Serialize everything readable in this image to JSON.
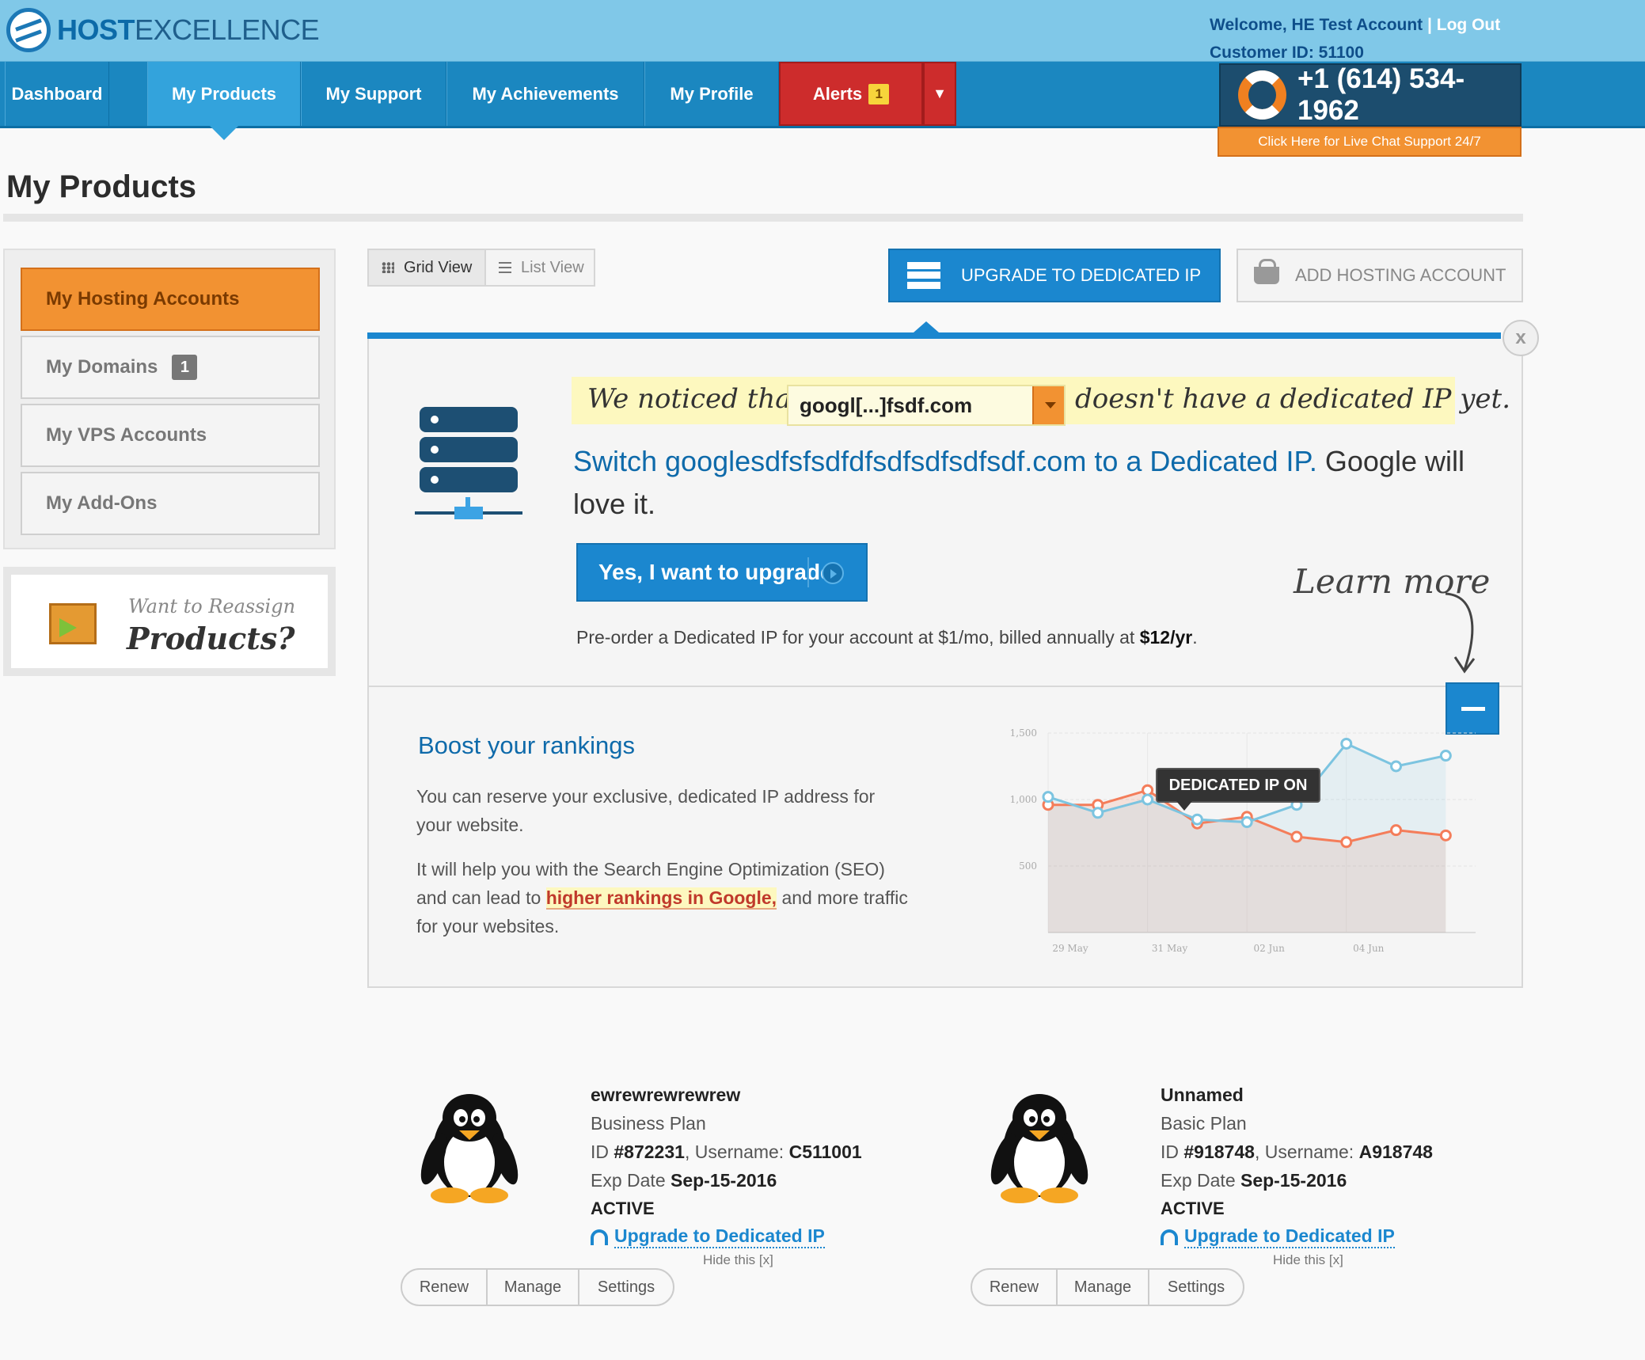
{
  "header": {
    "logo_host": "HOST",
    "logo_excellence": "EXCELLENCE",
    "welcome": "Welcome, HE Test Account",
    "separator": "|",
    "logout": "Log Out",
    "customer_id": "Customer ID: 51100",
    "phone": "+1 (614) 534-1962",
    "chat": "Click Here for Live Chat Support 24/7"
  },
  "nav": {
    "items": [
      "Dashboard",
      "My Products",
      "My Support",
      "My Achievements",
      "My Profile"
    ],
    "alerts_label": "Alerts",
    "alerts_count": "1"
  },
  "page": {
    "title": "My Products"
  },
  "sidebar": {
    "items": [
      {
        "label": "My Hosting Accounts"
      },
      {
        "label": "My Domains",
        "badge": "1"
      },
      {
        "label": "My VPS Accounts"
      },
      {
        "label": "My Add-Ons"
      }
    ],
    "reassign_small": "Want to Reassign",
    "reassign_big": "Products?"
  },
  "toolbar": {
    "grid_view": "Grid View",
    "list_view": "List View",
    "upgrade_ip": "UPGRADE TO DEDICATED IP",
    "add_hosting": "ADD HOSTING ACCOUNT",
    "close": "x"
  },
  "promo": {
    "notice_before": "We noticed that",
    "domain_selected": "googl[...]fsdf.com",
    "notice_after": "doesn't have a dedicated IP yet.",
    "switch_blue": "Switch googlesdfsfsdfdfsdfsdfsdfsdf.com to a Dedicated IP.",
    "switch_rest": "Google will love it.",
    "yes_button": "Yes, I want to upgrade",
    "preorder": "Pre-order a Dedicated IP for your account at $1/mo, billed annually at",
    "preorder_price": "$12/yr",
    "preorder_end": ".",
    "learn_more": "Learn more",
    "boost_title": "Boost your rankings",
    "boost_p1": "You can reserve your exclusive, dedicated IP address for your website.",
    "boost_p2_a": "It will help you with the Search Engine Optimization (SEO) and can lead to",
    "boost_p2_link": "higher rankings in Google,",
    "boost_p2_b": "and more traffic for your websites.",
    "tooltip": "DEDICATED IP ON"
  },
  "chart_data": {
    "type": "line",
    "categories": [
      "29 May",
      "31 May",
      "02 Jun",
      "04 Jun"
    ],
    "ytick_labels": [
      "1,500",
      "1,000",
      "500"
    ],
    "ylim": [
      0,
      1500
    ],
    "grid": true,
    "series": [
      {
        "color": "#f47d5a",
        "x": [
          0,
          1,
          2,
          3,
          4,
          5,
          6,
          7,
          8
        ],
        "values": [
          960,
          960,
          1070,
          820,
          870,
          720,
          680,
          770,
          730
        ]
      },
      {
        "color": "#7cc4e0",
        "x": [
          0,
          1,
          2,
          3,
          4,
          5,
          6,
          7,
          8
        ],
        "values": [
          1020,
          900,
          1000,
          850,
          830,
          960,
          1420,
          1250,
          1330
        ]
      }
    ],
    "annotation": "DEDICATED IP ON"
  },
  "accounts": [
    {
      "name": "ewrewrewrewrew",
      "plan": "Business Plan",
      "id_label": "ID",
      "id": "#872231",
      "username_label": ", Username:",
      "username": "C511001",
      "exp_label": "Exp Date",
      "exp": "Sep-15-2016",
      "status": "ACTIVE",
      "upgrade": "Upgrade to Dedicated IP",
      "hide": "Hide this [x]",
      "buttons": [
        "Renew",
        "Manage",
        "Settings"
      ]
    },
    {
      "name": "Unnamed",
      "plan": "Basic Plan",
      "id_label": "ID",
      "id": "#918748",
      "username_label": ", Username:",
      "username": "A918748",
      "exp_label": "Exp Date",
      "exp": "Sep-15-2016",
      "status": "ACTIVE",
      "upgrade": "Upgrade to Dedicated IP",
      "hide": "Hide this [x]",
      "buttons": [
        "Renew",
        "Manage",
        "Settings"
      ]
    }
  ]
}
